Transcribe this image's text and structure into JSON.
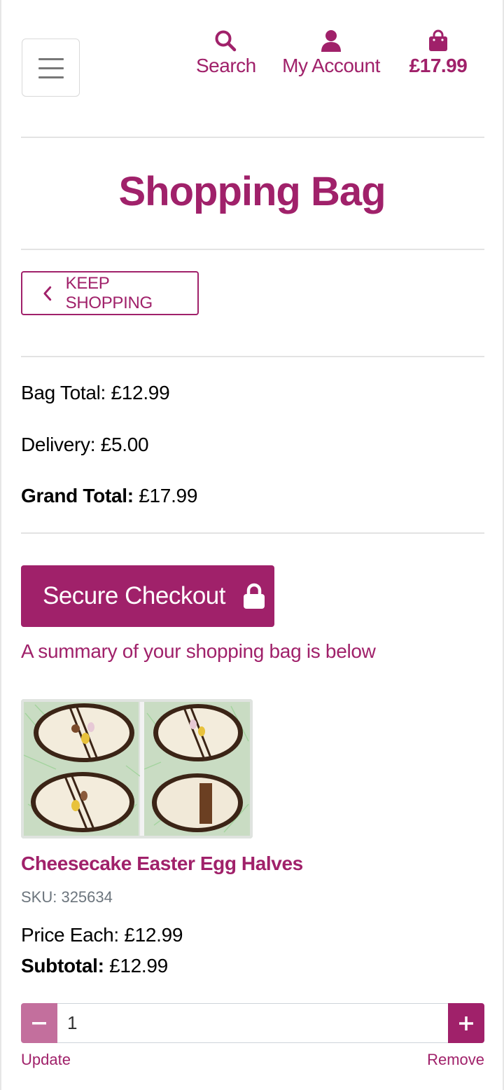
{
  "header": {
    "search_label": "Search",
    "account_label": "My Account",
    "bag_total": "£17.99",
    "icons": {
      "menu": "hamburger-icon",
      "search": "search-icon",
      "account": "user-icon",
      "bag": "shopping-bag-icon"
    }
  },
  "page": {
    "title": "Shopping Bag"
  },
  "keep_shopping": {
    "label": "KEEP SHOPPING",
    "icon": "chevron-left-icon"
  },
  "totals": {
    "bag_total_label": "Bag Total:",
    "bag_total_value": "£12.99",
    "delivery_label": "Delivery:",
    "delivery_value": "£5.00",
    "grand_total_label": "Grand Total:",
    "grand_total_value": "£17.99"
  },
  "checkout": {
    "label": "Secure Checkout",
    "icon": "lock-icon"
  },
  "summary_text": "A summary of your shopping bag is below",
  "items": [
    {
      "name": "Cheesecake Easter Egg Halves",
      "sku": "SKU: 325634",
      "price_label": "Price Each:",
      "price_value": "£12.99",
      "subtotal_label": "Subtotal:",
      "subtotal_value": "£12.99",
      "quantity": "1",
      "update_label": "Update",
      "remove_label": "Remove"
    }
  ],
  "colors": {
    "accent": "#a0216a",
    "accent_light": "#c36f9d",
    "divider": "#e3e3e3",
    "sku_gray": "#6c757d"
  }
}
